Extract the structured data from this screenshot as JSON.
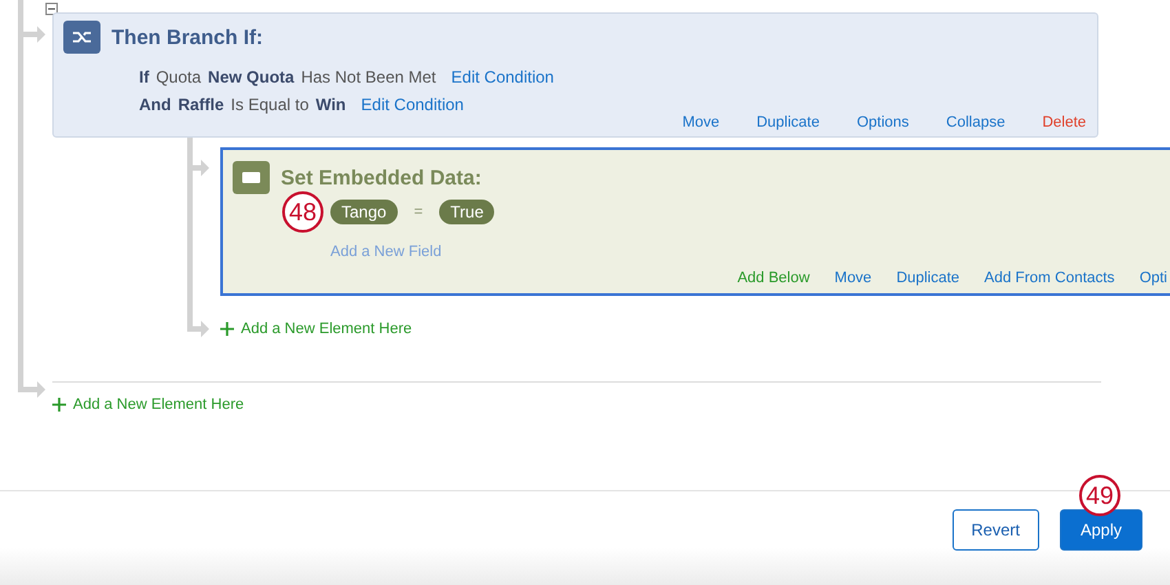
{
  "branch": {
    "title": "Then Branch If:",
    "conditions": [
      {
        "parts": [
          {
            "kind": "keyword",
            "text": "If"
          },
          {
            "kind": "text",
            "text": "Quota"
          },
          {
            "kind": "keyword",
            "text": "New Quota"
          },
          {
            "kind": "text",
            "text": "Has Not Been Met"
          },
          {
            "kind": "link",
            "text": "Edit Condition"
          }
        ]
      },
      {
        "parts": [
          {
            "kind": "keyword",
            "text": "And"
          },
          {
            "kind": "keyword",
            "text": "Raffle"
          },
          {
            "kind": "text",
            "text": "Is Equal to"
          },
          {
            "kind": "keyword",
            "text": "Win"
          },
          {
            "kind": "link",
            "text": "Edit Condition"
          }
        ]
      }
    ],
    "actions": [
      {
        "label": "Move",
        "kind": "normal"
      },
      {
        "label": "Duplicate",
        "kind": "normal"
      },
      {
        "label": "Options",
        "kind": "normal"
      },
      {
        "label": "Collapse",
        "kind": "normal"
      },
      {
        "label": "Delete",
        "kind": "danger"
      }
    ]
  },
  "embedded": {
    "title": "Set Embedded Data:",
    "badge": "48",
    "field": {
      "name": "Tango",
      "operator": "=",
      "value": "True"
    },
    "add_field": "Add a New Field",
    "actions": [
      {
        "label": "Add Below",
        "kind": "add"
      },
      {
        "label": "Move",
        "kind": "normal"
      },
      {
        "label": "Duplicate",
        "kind": "normal"
      },
      {
        "label": "Add From Contacts",
        "kind": "normal"
      },
      {
        "label": "Opti",
        "kind": "normal"
      }
    ]
  },
  "inner_add": "Add a New Element Here",
  "outer_add": "Add a New Element Here",
  "footer": {
    "buttons": [
      {
        "label": "Revert",
        "kind": "secondary"
      },
      {
        "label": "Apply",
        "kind": "primary",
        "badge": "49"
      }
    ]
  }
}
